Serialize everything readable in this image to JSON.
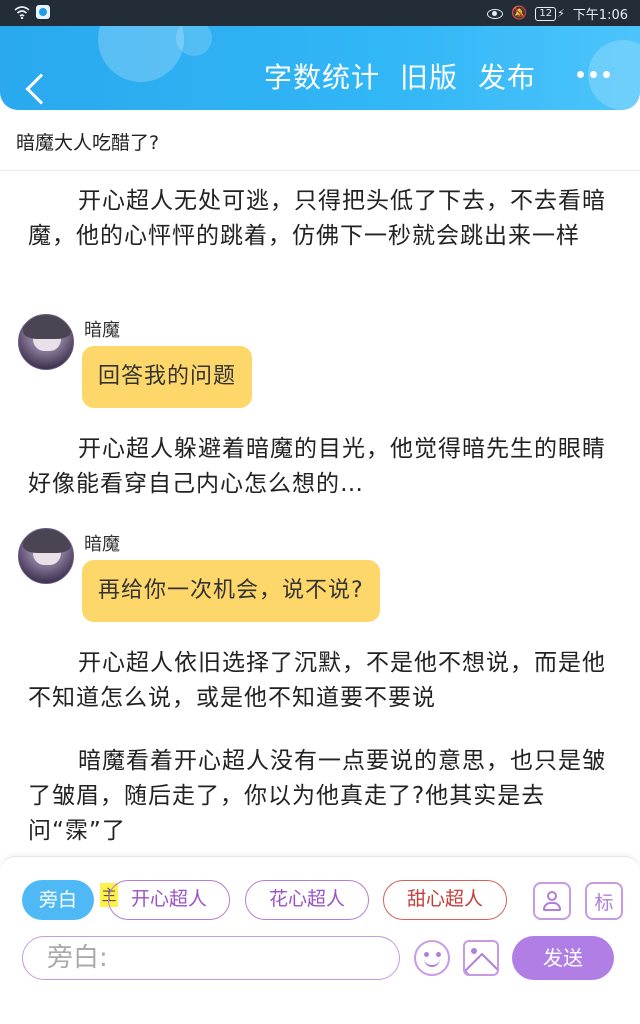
{
  "status_bar": {
    "time": "下午1:06",
    "battery": "12"
  },
  "header": {
    "actions": [
      "字数统计",
      "旧版",
      "发布"
    ]
  },
  "document": {
    "title": "暗魔大人吃醋了?"
  },
  "content": {
    "paragraph_1": "开心超人无处可逃，只得把头低了下去，不去看暗魔，他的心怦怦的跳着，仿佛下一秒就会跳出来一样",
    "dialog_1": {
      "speaker": "暗魔",
      "message": "回答我的问题"
    },
    "paragraph_2": "开心超人躲避着暗魔的目光，他觉得暗先生的眼睛好像能看穿自己内心怎么想的…",
    "dialog_2": {
      "speaker": "暗魔",
      "message": "再给你一次机会，说不说?"
    },
    "paragraph_3": "开心超人依旧选择了沉默，不是他不想说，而是他不知道怎么说，或是他不知道要不要说",
    "paragraph_4": "暗魔看着开心超人没有一点要说的意思，也只是皱了皱眉，随后走了，你以为他真走了?他其实是去问“霂”了"
  },
  "composer": {
    "roles": {
      "narration": "旁白",
      "host_badge": "主",
      "role_1": "开心超人",
      "role_2": "花心超人",
      "role_3": "甜心超人"
    },
    "tag_button": "标",
    "input_placeholder": "旁白:",
    "send_label": "发送",
    "accent_color": "#b17ee6",
    "narration_color": "#4fb9f5"
  }
}
